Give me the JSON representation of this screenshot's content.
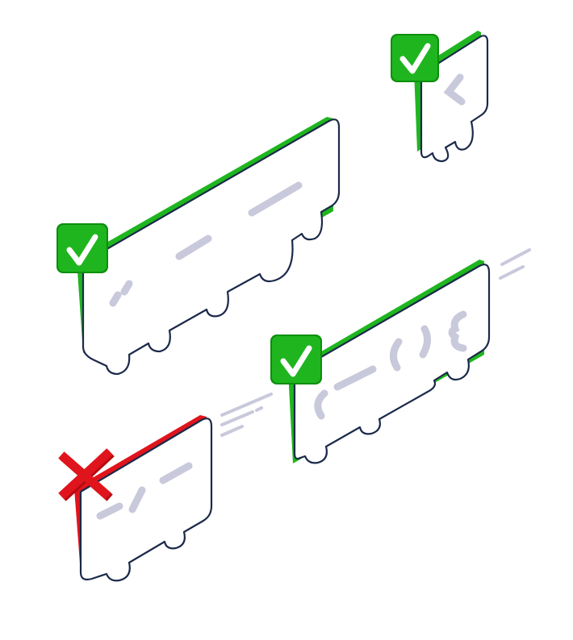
{
  "colors": {
    "success": "#1fb51f",
    "success_dark": "#0c8f0c",
    "error": "#e0141c",
    "error_dark": "#b20c12",
    "outline": "#1b2a4a",
    "code_marks": "#c9c9dc",
    "background": "#ffffff"
  },
  "blocks": [
    {
      "id": "top-small-block",
      "status": "valid",
      "status_icon": "check-icon",
      "glyph": "<"
    },
    {
      "id": "top-wide-block",
      "status": "valid",
      "status_icon": "check-icon",
      "glyph": "// — —"
    },
    {
      "id": "middle-block",
      "status": "valid",
      "status_icon": "check-icon",
      "glyph": "( — ( ) {"
    },
    {
      "id": "bottom-block",
      "status": "invalid",
      "status_icon": "cross-icon",
      "glyph": "— / —"
    }
  ],
  "connectors": [
    {
      "id": "connector-middle-to-bottom",
      "style": "dashed"
    },
    {
      "id": "connector-right-edge",
      "style": "dashed"
    }
  ]
}
